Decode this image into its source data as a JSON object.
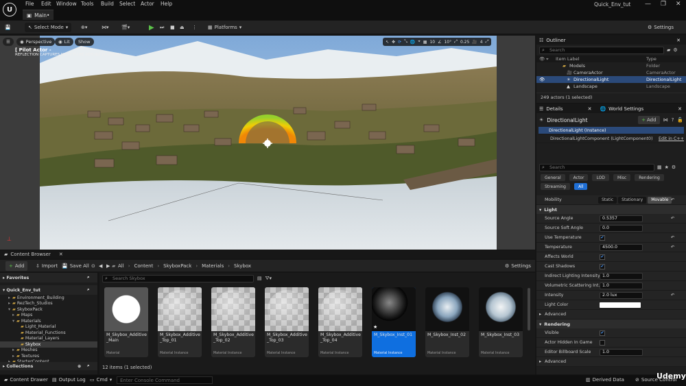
{
  "titlebar": {
    "app_tab": "Main•",
    "window_title": "Quick_Env_tut",
    "menus": [
      "File",
      "Edit",
      "Window",
      "Tools",
      "Build",
      "Select",
      "Actor",
      "Help"
    ]
  },
  "toolbar": {
    "select_mode": "Select Mode",
    "platforms": "Platforms",
    "settings": "Settings"
  },
  "viewport": {
    "perspective": "Perspective",
    "lit": "Lit",
    "show": "Show",
    "pilot_label": "[ Pilot Actor - ",
    "pilot_sub": "REFLECTION CAPTURES NEED TO BE REBUILT (1 unbuilt)",
    "tools": {
      "grid": "10",
      "angle": "10°",
      "scale": "0.25",
      "camera": "4"
    }
  },
  "outliner": {
    "tab": "Outliner",
    "search_placeholder": "Search",
    "col_label": "Item Label",
    "col_type": "Type",
    "rows": [
      {
        "label": "Models",
        "type": "Folder"
      },
      {
        "label": "CameraActor",
        "type": "CameraActor"
      },
      {
        "label": "DirectionalLight",
        "type": "DirectionalLight"
      },
      {
        "label": "Landscape",
        "type": "Landscape"
      }
    ],
    "footer": "249 actors (1 selected)"
  },
  "details": {
    "tab": "Details",
    "tab2": "World Settings",
    "actor_name": "DirectionalLight",
    "add_label": "Add",
    "instance": "DirectionalLight (Instance)",
    "component": "DirectionalLightComponent (LightComponent0)",
    "edit_cpp": "Edit in C++",
    "search_placeholder": "Search",
    "filters": [
      "General",
      "Actor",
      "LOD",
      "Misc",
      "Rendering",
      "Streaming",
      "All"
    ],
    "mobility": {
      "label": "Mobility",
      "options": [
        "Static",
        "Stationary",
        "Movable"
      ],
      "selected": "Movable"
    },
    "light_section": "Light",
    "light_rows": [
      {
        "label": "Source Angle",
        "value": "0.5357"
      },
      {
        "label": "Source Soft Angle",
        "value": "0.0"
      },
      {
        "label": "Use Temperature",
        "check": true
      },
      {
        "label": "Temperature",
        "value": "4500.0"
      },
      {
        "label": "Affects World",
        "check": true
      },
      {
        "label": "Cast Shadows",
        "check": true
      },
      {
        "label": "Indirect Lighting Intensity",
        "value": "1.0"
      },
      {
        "label": "Volumetric Scattering Int...",
        "value": "1.0"
      },
      {
        "label": "Intensity",
        "value": "2.0 lux"
      },
      {
        "label": "Light Color",
        "color": "#ffffff"
      },
      {
        "label": "Advanced",
        "expand": true
      }
    ],
    "rendering_section": "Rendering",
    "rendering_rows": [
      {
        "label": "Visible",
        "check": true
      },
      {
        "label": "Actor Hidden In Game",
        "check": false
      },
      {
        "label": "Editor Billboard Scale",
        "value": "1.0"
      },
      {
        "label": "Advanced",
        "expand": true
      }
    ]
  },
  "content_browser": {
    "tab": "Content Browser",
    "add": "Add",
    "import": "Import",
    "save_all": "Save All",
    "breadcrumb": [
      "All",
      "Content",
      "SkyboxPack",
      "Materials",
      "Skybox"
    ],
    "settings": "Settings",
    "favorites": "Favorites",
    "project": "Quick_Env_tut",
    "tree": [
      {
        "label": "Environment_Building",
        "indent": 2
      },
      {
        "label": "RezTech_Studios",
        "indent": 2
      },
      {
        "label": "SkyboxPack",
        "indent": 2
      },
      {
        "label": "Maps",
        "indent": 3
      },
      {
        "label": "Materials",
        "indent": 3
      },
      {
        "label": "Light_Material",
        "indent": 4
      },
      {
        "label": "Material_Functions",
        "indent": 4
      },
      {
        "label": "Material_Layers",
        "indent": 4
      },
      {
        "label": "Skybox",
        "indent": 4,
        "selected": true
      },
      {
        "label": "Meshes",
        "indent": 3
      },
      {
        "label": "Textures",
        "indent": 3
      },
      {
        "label": "StarterContent",
        "indent": 2
      }
    ],
    "collections": "Collections",
    "search_placeholder": "Search Skybox",
    "assets": [
      {
        "name": "M_Skybox_Additive_Main",
        "type": "Material",
        "thumb": "white"
      },
      {
        "name": "M_Skybox_Additive_Top_01",
        "type": "Material Instance",
        "thumb": "checker"
      },
      {
        "name": "M_Skybox_Additive_Top_02",
        "type": "Material Instance",
        "thumb": "checker"
      },
      {
        "name": "M_Skybox_Additive_Top_03",
        "type": "Material Instance",
        "thumb": "checker"
      },
      {
        "name": "M_Skybox_Additive_Top_04",
        "type": "Material Instance",
        "thumb": "checker"
      },
      {
        "name": "M_Skybox_Inst_01",
        "type": "Material Instance",
        "thumb": "dark",
        "selected": true
      },
      {
        "name": "M_Skybox_Inst_02",
        "type": "Material Instance",
        "thumb": "sky"
      },
      {
        "name": "M_Skybox_Inst_03",
        "type": "Material Instance",
        "thumb": "sky2"
      }
    ],
    "item_count": "12 items (1 selected)"
  },
  "statusbar": {
    "content_drawer": "Content Drawer",
    "output_log": "Output Log",
    "cmd": "Cmd",
    "console_placeholder": "Enter Console Command",
    "derived_data": "Derived Data",
    "source_control": "Source Control",
    "watermark": "Udemy"
  }
}
